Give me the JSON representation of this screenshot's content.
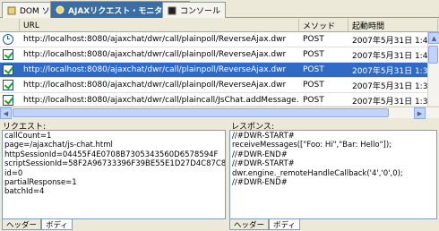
{
  "tabs": [
    {
      "label": "DOM ソース",
      "icon": "dom-source-icon",
      "active": false
    },
    {
      "label": "AJAXリクエスト・モニター",
      "icon": "ajax-monitor-icon",
      "active": true,
      "close": "✕"
    },
    {
      "label": "コンソール",
      "icon": "console-icon",
      "active": false
    }
  ],
  "table": {
    "columns": [
      "URL",
      "メソッド",
      "起動時間"
    ],
    "rows": [
      {
        "status": "clock-icon",
        "url": "http://localhost:8080/ajaxchat/dwr/call/plainpoll/ReverseAjax.dwr",
        "method": "POST",
        "time": "2007年5月31日 1:41:11",
        "selected": false
      },
      {
        "status": "check-icon",
        "url": "http://localhost:8080/ajaxchat/dwr/call/plainpoll/ReverseAjax.dwr",
        "method": "POST",
        "time": "2007年5月31日 1:40:10",
        "selected": false
      },
      {
        "status": "check-icon",
        "url": "http://localhost:8080/ajaxchat/dwr/call/plainpoll/ReverseAjax.dwr",
        "method": "POST",
        "time": "2007年5月31日 1:39:10",
        "selected": true
      },
      {
        "status": "check-icon",
        "url": "http://localhost:8080/ajaxchat/dwr/call/plainpoll/ReverseAjax.dwr",
        "method": "POST",
        "time": "2007年5月31日 1:38:10",
        "selected": false
      },
      {
        "status": "check-icon",
        "url": "http://localhost:8080/ajaxchat/dwr/call/plaincall/JsChat.addMessage.dwr",
        "method": "POST",
        "time": "2007年5月31日 1:37:22",
        "selected": false
      }
    ]
  },
  "request": {
    "label": "リクエスト:",
    "body": "callCount=1\npage=/ajaxchat/js-chat.html\nhttpSessionId=04455F4E0708B7305343560D6578594F\nscriptSessionId=58F2A96733396F39BE55E1D27D4C87C894\nid=0\npartialResponse=1\nbatchId=4",
    "tabs": [
      "ヘッダー",
      "ボディ"
    ],
    "active_tab": "ボディ"
  },
  "response": {
    "label": "レスポンス:",
    "body": "//#DWR-START#\nreceiveMessages([\"Foo: Hi\",\"Bar: Hello\"]);\n//#DWR-END#\n//#DWR-START#\ndwr.engine._remoteHandleCallback('4','0',0);\n//#DWR-END#",
    "tabs": [
      "ヘッダー",
      "ボディ"
    ],
    "active_tab": "ボディ"
  }
}
